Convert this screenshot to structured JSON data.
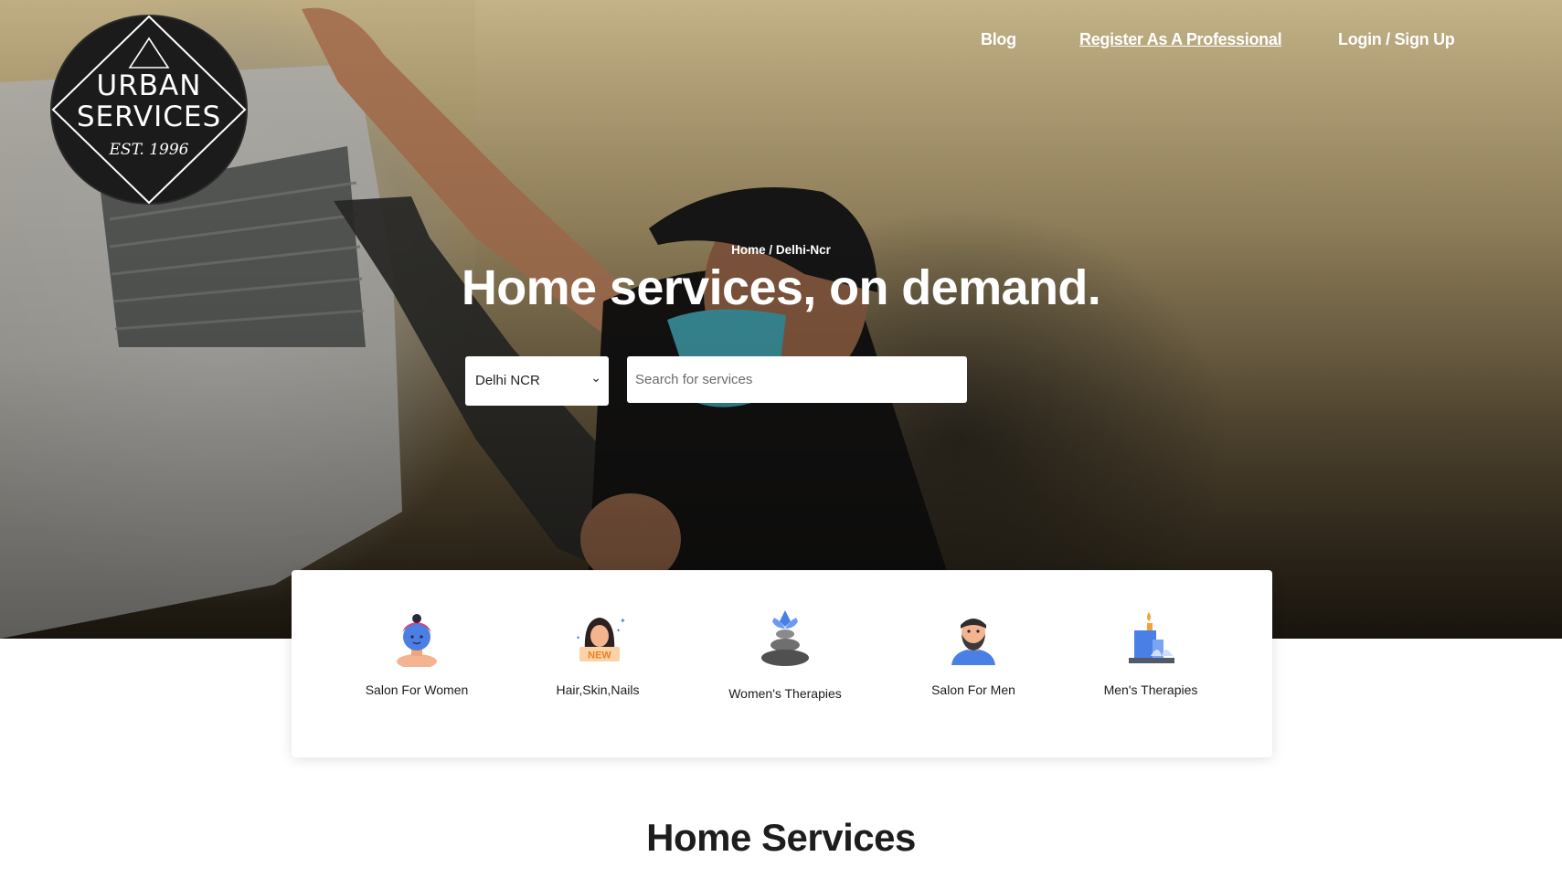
{
  "logo": {
    "line1": "URBAN",
    "line2": "SERVICES",
    "est": "EST. 1996"
  },
  "nav": {
    "blog": "Blog",
    "register": "Register As A Professional",
    "login": "Login / Sign Up"
  },
  "hero": {
    "breadcrumb": "Home / Delhi-Ncr",
    "title": "Home services, on demand.",
    "city_selected": "Delhi NCR",
    "search_placeholder": "Search for services"
  },
  "categories": [
    {
      "label": "Salon For Women",
      "icon": "woman-face-mask-icon"
    },
    {
      "label": "Hair,Skin,Nails",
      "icon": "woman-new-badge-icon",
      "badge": "NEW"
    },
    {
      "label": "Women's Therapies",
      "icon": "spa-stones-icon"
    },
    {
      "label": "Salon For Men",
      "icon": "bearded-man-icon"
    },
    {
      "label": "Men's Therapies",
      "icon": "candle-spa-icon"
    }
  ],
  "section": {
    "title": "Home Services"
  },
  "colors": {
    "card_bg": "#ffffff",
    "text_dark": "#1d1d1d",
    "icon_blue": "#4a7fe6",
    "badge_orange": "#f6a13c"
  }
}
